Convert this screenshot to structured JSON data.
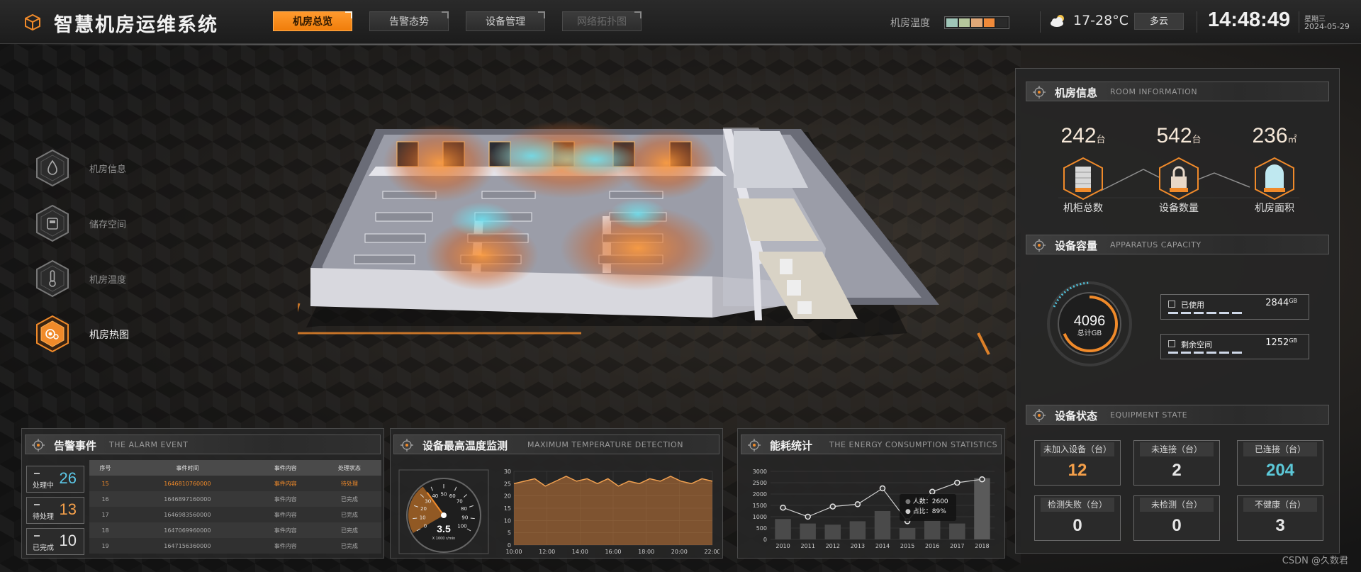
{
  "header": {
    "title": "智慧机房运维系统",
    "tabs": [
      {
        "label": "机房总览",
        "active": true
      },
      {
        "label": "告警态势",
        "active": false
      },
      {
        "label": "设备管理",
        "active": false
      },
      {
        "label": "网络拓扑图",
        "active": false,
        "dim": true
      }
    ],
    "temp_label": "机房温度",
    "temp_bar_colors": [
      "#9fc6b8",
      "#b5c69c",
      "#e0a878",
      "#f08a3a",
      "#2a2a2a"
    ],
    "weather_icon": "partly-cloudy-icon",
    "temp_range": "17-28°C",
    "weather": "多云",
    "time": "14:48:49",
    "weekday": "星期三",
    "date": "2024-05-29"
  },
  "left_menu": [
    {
      "label": "机房信息",
      "icon": "drop-icon",
      "active": false
    },
    {
      "label": "储存空间",
      "icon": "storage-icon",
      "active": false
    },
    {
      "label": "机房温度",
      "icon": "thermometer-icon",
      "active": false
    },
    {
      "label": "机房热图",
      "icon": "heatmap-icon",
      "active": true
    }
  ],
  "room_info": {
    "title_zh": "机房信息",
    "title_en": "ROOM INFORMATION",
    "stats": [
      {
        "value": "242",
        "unit": "台",
        "label": "机柜总数",
        "icon": "cabinet-icon"
      },
      {
        "value": "542",
        "unit": "台",
        "label": "设备数量",
        "icon": "lock-device-icon"
      },
      {
        "value": "236",
        "unit": "㎡",
        "label": "机房面积",
        "icon": "area-icon"
      }
    ]
  },
  "capacity": {
    "title_zh": "设备容量",
    "title_en": "APPARATUS CAPACITY",
    "total": "4096",
    "total_label": "总计GB",
    "used_fraction": 0.69,
    "items": [
      {
        "label": "已使用",
        "value": "2844",
        "unit": "GB"
      },
      {
        "label": "剩余空间",
        "value": "1252",
        "unit": "GB"
      }
    ]
  },
  "equipment_state": {
    "title_zh": "设备状态",
    "title_en": "EQUIPMENT STATE",
    "cards": [
      {
        "label": "未加入设备（台）",
        "value": "12",
        "color": "#f5a04a"
      },
      {
        "label": "未连接（台）",
        "value": "2",
        "color": "#e6e6e6"
      },
      {
        "label": "已连接（台）",
        "value": "204",
        "color": "#5cc8d8"
      },
      {
        "label": "检测失败（台）",
        "value": "0",
        "color": "#e6e6e6"
      },
      {
        "label": "未检测（台）",
        "value": "0",
        "color": "#e6e6e6"
      },
      {
        "label": "不健康（台）",
        "value": "3",
        "color": "#e6e6e6"
      }
    ]
  },
  "alarm": {
    "title_zh": "告警事件",
    "title_en": "THE ALARM EVENT",
    "counts": [
      {
        "label": "处理中",
        "value": "26",
        "color": "#5cc8e8"
      },
      {
        "label": "待处理",
        "value": "13",
        "color": "#f5a04a"
      },
      {
        "label": "已完成",
        "value": "10",
        "color": "#e6e6e6"
      }
    ],
    "columns": [
      "序号",
      "事件时间",
      "事件内容",
      "处理状态"
    ],
    "rows": [
      [
        "15",
        "1646810760000",
        "事件内容",
        "待处理"
      ],
      [
        "16",
        "1646897160000",
        "事件内容",
        "已完成"
      ],
      [
        "17",
        "1646983560000",
        "事件内容",
        "已完成"
      ],
      [
        "18",
        "1647069960000",
        "事件内容",
        "已完成"
      ],
      [
        "19",
        "1647156360000",
        "事件内容",
        "已完成"
      ]
    ]
  },
  "temperature": {
    "title_zh": "设备最高温度监测",
    "title_en": "MAXIMUM TEMPERATURE DETECTION",
    "gauge": {
      "value": "3.5",
      "unit": "X 1000 r/min",
      "ticks": [
        "0",
        "10",
        "20",
        "30",
        "40",
        "50",
        "60",
        "70",
        "80",
        "90",
        "100"
      ],
      "max": 100
    }
  },
  "energy": {
    "title_zh": "能耗统计",
    "title_en": "THE ENERGY CONSUMPTION STATISTICS",
    "tooltip": {
      "row1_label": "人数：",
      "row1_value": "2600",
      "row2_label": "占比：",
      "row2_value": "89%"
    }
  },
  "watermark": "CSDN @久数君",
  "chart_data": [
    {
      "type": "area",
      "x": [
        "10:00",
        "10:40",
        "11:20",
        "12:00",
        "12:40",
        "13:20",
        "14:00",
        "14:40",
        "15:20",
        "16:00",
        "16:40",
        "17:20",
        "18:00",
        "18:40",
        "19:20",
        "20:00",
        "20:40",
        "21:20",
        "22:00",
        "22:40"
      ],
      "tick_labels": [
        "10:00",
        "12:00",
        "14:00",
        "16:00",
        "18:00",
        "20:00",
        "22:00"
      ],
      "values": [
        25,
        26,
        27,
        24,
        26,
        28,
        26,
        27,
        25,
        27,
        24,
        26,
        25,
        27,
        26,
        28,
        26,
        25,
        27,
        26
      ],
      "ylim": [
        0,
        30
      ],
      "yticks": [
        0,
        5,
        10,
        15,
        20,
        25,
        30
      ],
      "grid": true
    },
    {
      "type": "bar",
      "categories": [
        "2010",
        "2011",
        "2012",
        "2013",
        "2014",
        "2015",
        "2016",
        "2017",
        "2018"
      ],
      "series": [
        {
          "type": "bar",
          "values": [
            900,
            700,
            650,
            800,
            1250,
            500,
            900,
            700,
            2700
          ]
        },
        {
          "type": "line",
          "values": [
            1400,
            1000,
            1450,
            1550,
            2250,
            800,
            2100,
            2500,
            2650
          ]
        }
      ],
      "ylim": [
        0,
        3000
      ],
      "yticks": [
        0,
        500,
        1000,
        1500,
        2000,
        2500,
        3000
      ],
      "grid": true
    }
  ]
}
